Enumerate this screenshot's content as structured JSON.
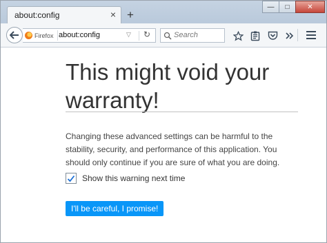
{
  "tab": {
    "title": "about:config",
    "close_glyph": "×"
  },
  "newtab_glyph": "+",
  "window_controls": {
    "minimize": "—",
    "maximize": "□",
    "close": "✕"
  },
  "urlbar": {
    "identity": "Firefox",
    "url": "about:config"
  },
  "search": {
    "placeholder": "Search"
  },
  "icons": [
    "back-arrow-icon",
    "firefox-logo-icon",
    "dropdown-arrow-icon",
    "reload-icon",
    "search-icon",
    "bookmark-star-icon",
    "reading-list-icon",
    "pocket-icon",
    "overflow-chevron-icon",
    "hamburger-menu-icon"
  ],
  "content": {
    "heading": "This might void your warranty!",
    "message": "Changing these advanced settings can be harmful to the stability, security, and performance of this application. You should only continue if you are sure of what you are doing.",
    "checkbox_label": "Show this warning next time",
    "checkbox_checked": true,
    "button_label": "I'll be careful, I promise!"
  },
  "colors": {
    "accent": "#0996f8",
    "chrome": "#b9c9db"
  }
}
